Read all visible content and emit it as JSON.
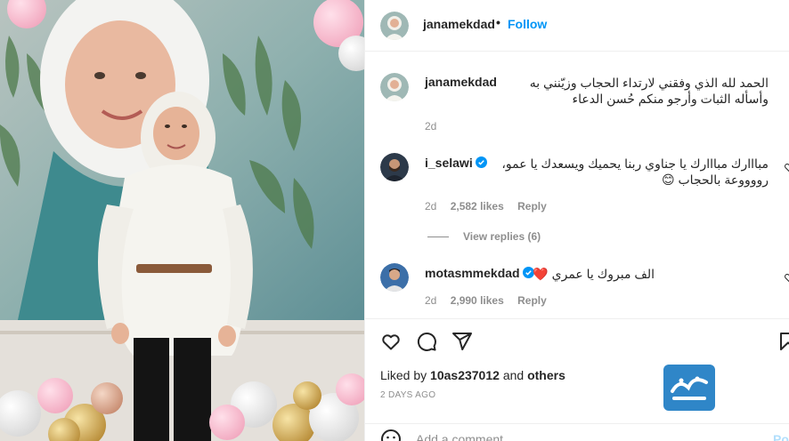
{
  "post": {
    "username": "janamekdad",
    "follow_label": "Follow",
    "separator": "•",
    "caption": "الحمد لله الذي وفقني لارتداء الحجاب وزيّنني به وأسأله الثبات وأرجو منكم حُسن الدعاء",
    "caption_time": "2d"
  },
  "comments": [
    {
      "username": "i_selawi",
      "verified": true,
      "text": "مبااارك مبااارك يا جناوي ربنا يحميك ويسعدك يا عمو، رووووعة بالحجاب 😊",
      "time": "2d",
      "likes": "2,582 likes",
      "reply_label": "Reply",
      "view_replies": "View replies (6)"
    },
    {
      "username": "motasmmekdad",
      "verified": true,
      "text": "الف مبروك يا عمري ❤️",
      "time": "2d",
      "likes": "2,990 likes",
      "reply_label": "Reply"
    }
  ],
  "footer": {
    "liked_by_prefix": "Liked by",
    "liked_by_user": "10as237012",
    "liked_by_and": "and",
    "liked_by_others": "others",
    "date": "2 DAYS AGO",
    "add_comment_placeholder": "Add a comment...",
    "post_label": "Post"
  },
  "colors": {
    "follow": "#0095f6",
    "verified": "#0095f6",
    "muted": "#8e8e8e",
    "text": "#262626"
  },
  "icons": [
    "like-icon",
    "comment-icon",
    "share-icon",
    "save-icon",
    "emoji-icon",
    "verified-badge-icon",
    "comment-like-icon"
  ]
}
